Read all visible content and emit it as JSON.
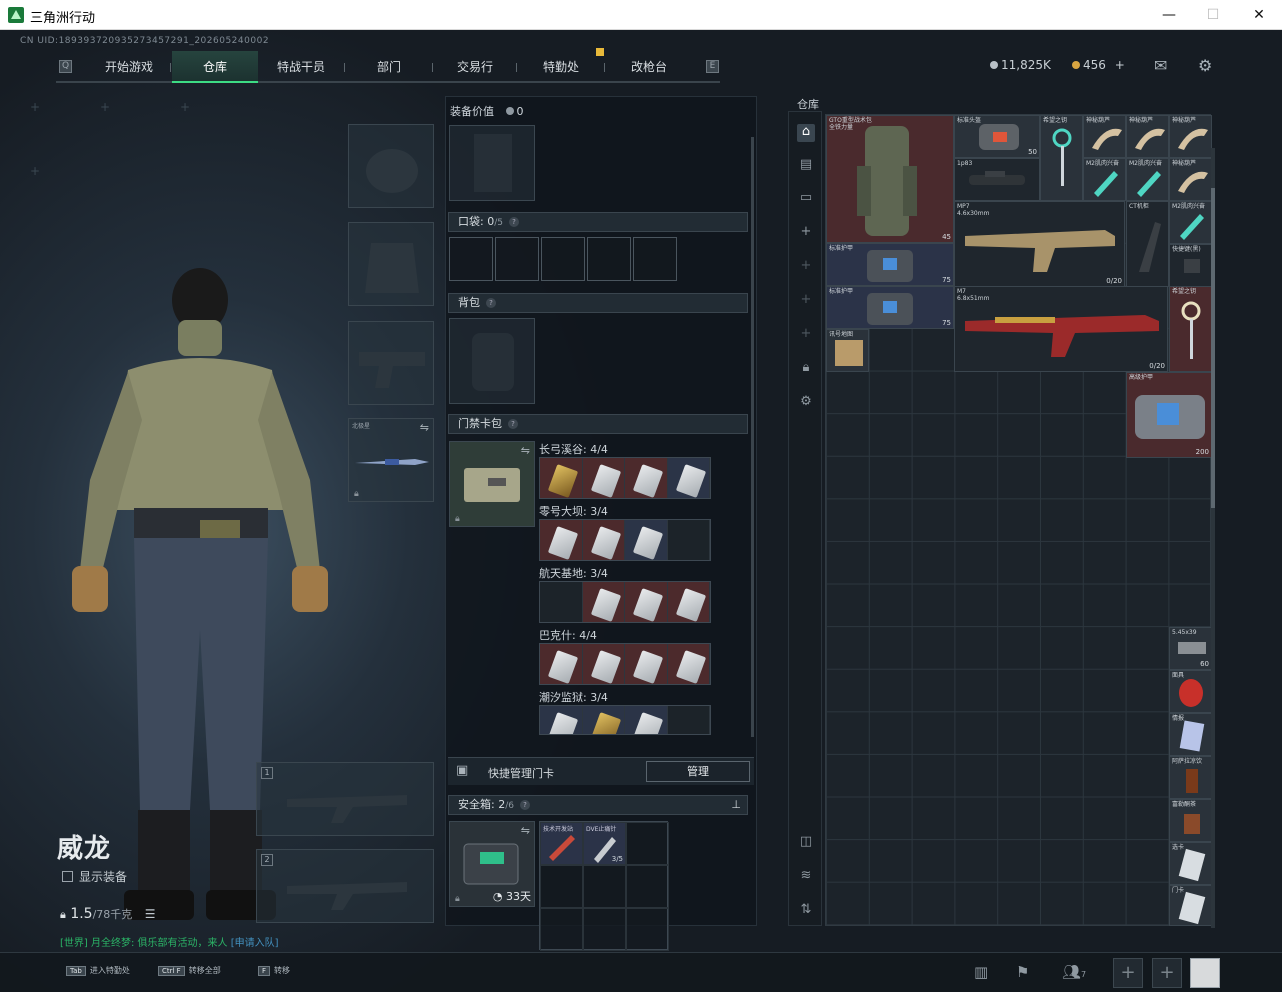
{
  "window": {
    "title": "三角洲行动",
    "minimize": "—",
    "maximize": "☐",
    "close": "✕"
  },
  "uid_line": "CN UID:189393720935273457291_202605240002",
  "nav": {
    "tabs": [
      "开始游戏",
      "仓库",
      "特战干员",
      "部门",
      "交易行",
      "特勤处",
      "改枪台"
    ],
    "active": "仓库",
    "left_key": "Q",
    "right_key": "E"
  },
  "currency": {
    "haf": "11,825K",
    "coupon": "456",
    "plus": "+"
  },
  "character": {
    "name": "威龙",
    "show_equipment": "显示装备",
    "weight": "1.5",
    "weight_max": "/78千克"
  },
  "chat": {
    "channel": "[世界]",
    "text": "月全终梦: 俱乐部有活动，来人",
    "link": "[申请入队]"
  },
  "loadout": {
    "melee_label": "北极星",
    "weapon_slot_1": "1",
    "weapon_slot_2": "2"
  },
  "middle": {
    "equip_value_label": "装备价值",
    "equip_value": "0",
    "pocket_label": "口袋:",
    "pocket_value": "0",
    "pocket_max": "/5",
    "backpack_label": "背包",
    "keycard_label": "门禁卡包",
    "maps": [
      {
        "name": "长弓溪谷: 4/4"
      },
      {
        "name": "零号大坝: 3/4"
      },
      {
        "name": "航天基地: 3/4"
      },
      {
        "name": "巴克什: 4/4"
      },
      {
        "name": "潮汐监狱: 3/4"
      }
    ],
    "quick_manage": "快捷管理门卡",
    "manage_button": "管理",
    "safe_label": "安全箱:",
    "safe_value": "2",
    "safe_max": "/6",
    "safe_timer": "33天",
    "safe_items": [
      {
        "name": "技术开发站",
        "count": ""
      },
      {
        "name": "DVE止痛针",
        "count": "3/5"
      }
    ]
  },
  "warehouse": {
    "title": "仓库",
    "items": [
      {
        "name": "GTO重型战术包\n全铁力量",
        "count": "45"
      },
      {
        "name": "标准头盔",
        "count": "50"
      },
      {
        "name": "希望之钥",
        "count": ""
      },
      {
        "name": "神秘葫芦",
        "count": ""
      },
      {
        "name": "神秘葫芦",
        "count": ""
      },
      {
        "name": "神秘葫芦",
        "count": ""
      },
      {
        "name": "1p83",
        "count": ""
      },
      {
        "name": "M2肌肉兴奋",
        "count": ""
      },
      {
        "name": "M2肌肉兴奋",
        "count": ""
      },
      {
        "name": "神秘葫芦",
        "count": ""
      },
      {
        "name": "MP7\n4.6x30mm",
        "count": "0/20"
      },
      {
        "name": "CT机柜",
        "count": ""
      },
      {
        "name": "M2肌肉兴奋",
        "count": ""
      },
      {
        "name": "标准护甲",
        "count": "75"
      },
      {
        "name": "快捷键(黑)",
        "count": ""
      },
      {
        "name": "标准护甲",
        "count": "75"
      },
      {
        "name": "M7\n6.8x51mm",
        "count": "0/20"
      },
      {
        "name": "希望之钥",
        "count": ""
      },
      {
        "name": "讯号地图",
        "count": ""
      },
      {
        "name": "高级护甲",
        "count": "200"
      },
      {
        "name": "5.45x39",
        "count": "60"
      },
      {
        "name": "面具",
        "count": ""
      },
      {
        "name": "情报",
        "count": ""
      },
      {
        "name": "阿萨拉凉饮",
        "count": ""
      },
      {
        "name": "富勒酮茶",
        "count": ""
      },
      {
        "name": "选卡",
        "count": ""
      },
      {
        "name": "门卡",
        "count": ""
      }
    ]
  },
  "hotkeys": [
    {
      "key": "Tab",
      "label": "进入特勤处"
    },
    {
      "key": "Ctrl F",
      "label": "转移全部"
    },
    {
      "key": "F",
      "label": "转移"
    }
  ],
  "social": {
    "friends": "7"
  },
  "icons": [
    "search-icon",
    "mail-icon",
    "gear-icon",
    "lock-icon",
    "swap-icon",
    "pin-icon"
  ],
  "colors": {
    "accent": "#3ddc84",
    "item_red": "#4a2a2d",
    "item_blue": "#2b3348"
  }
}
